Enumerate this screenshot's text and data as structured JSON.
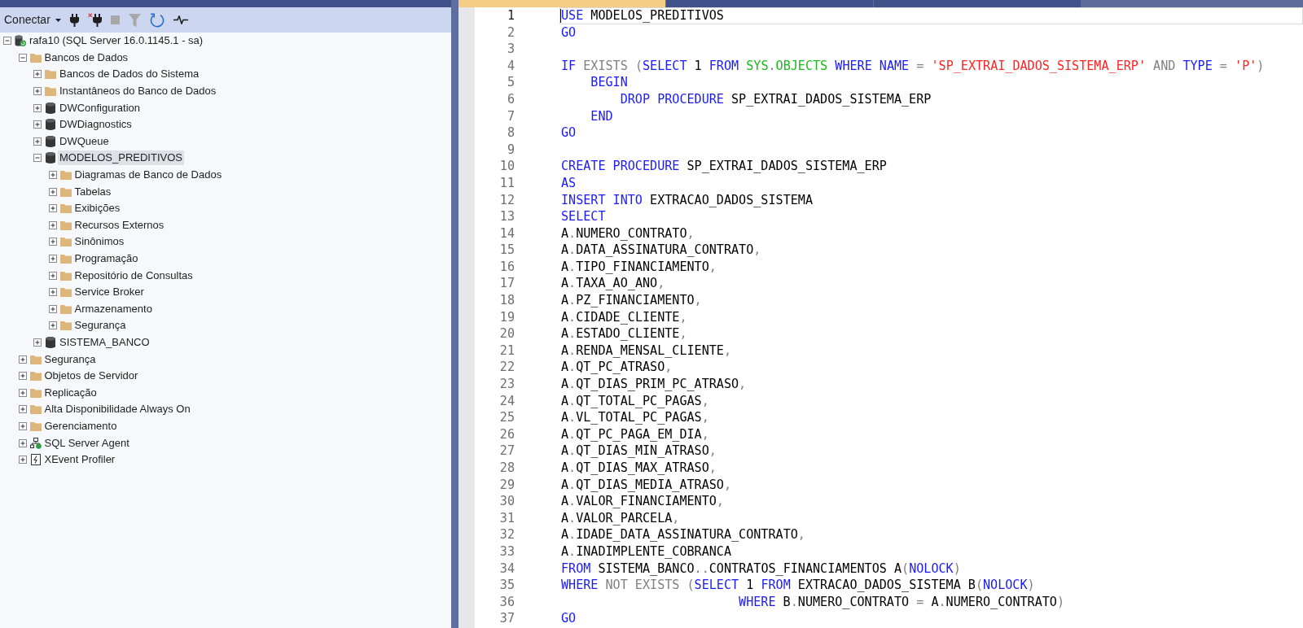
{
  "toolbar": {
    "connect_label": "Conectar",
    "buttons": [
      {
        "kind": "connect",
        "disabled": false
      },
      {
        "kind": "disconnect",
        "disabled": false
      },
      {
        "kind": "stop",
        "disabled": true
      },
      {
        "kind": "filter",
        "disabled": true
      },
      {
        "kind": "refresh",
        "disabled": false
      },
      {
        "kind": "activity",
        "disabled": false
      }
    ]
  },
  "tree": [
    {
      "label": "rafa10 (SQL Server 16.0.1145.1 - sa)",
      "kind": "server",
      "expanded": true,
      "selected": false,
      "children": [
        {
          "label": "Bancos de Dados",
          "kind": "folder",
          "expanded": true,
          "selected": false,
          "children": [
            {
              "label": "Bancos de Dados do Sistema",
              "kind": "folder",
              "expanded": false,
              "selected": false
            },
            {
              "label": "Instantâneos do Banco de Dados",
              "kind": "folder",
              "expanded": false,
              "selected": false
            },
            {
              "label": "DWConfiguration",
              "kind": "database",
              "expanded": false,
              "selected": false
            },
            {
              "label": "DWDiagnostics",
              "kind": "database",
              "expanded": false,
              "selected": false
            },
            {
              "label": "DWQueue",
              "kind": "database",
              "expanded": false,
              "selected": false
            },
            {
              "label": "MODELOS_PREDITIVOS",
              "kind": "database",
              "expanded": true,
              "selected": true,
              "children": [
                {
                  "label": "Diagramas de Banco de Dados",
                  "kind": "folder",
                  "expanded": false,
                  "selected": false
                },
                {
                  "label": "Tabelas",
                  "kind": "folder",
                  "expanded": false,
                  "selected": false
                },
                {
                  "label": "Exibições",
                  "kind": "folder",
                  "expanded": false,
                  "selected": false
                },
                {
                  "label": "Recursos Externos",
                  "kind": "folder",
                  "expanded": false,
                  "selected": false
                },
                {
                  "label": "Sinônimos",
                  "kind": "folder",
                  "expanded": false,
                  "selected": false
                },
                {
                  "label": "Programação",
                  "kind": "folder",
                  "expanded": false,
                  "selected": false
                },
                {
                  "label": "Repositório de Consultas",
                  "kind": "folder",
                  "expanded": false,
                  "selected": false
                },
                {
                  "label": "Service Broker",
                  "kind": "folder",
                  "expanded": false,
                  "selected": false
                },
                {
                  "label": "Armazenamento",
                  "kind": "folder",
                  "expanded": false,
                  "selected": false
                },
                {
                  "label": "Segurança",
                  "kind": "folder",
                  "expanded": false,
                  "selected": false
                }
              ]
            },
            {
              "label": "SISTEMA_BANCO",
              "kind": "database",
              "expanded": false,
              "selected": false
            }
          ]
        },
        {
          "label": "Segurança",
          "kind": "folder",
          "expanded": false,
          "selected": false
        },
        {
          "label": "Objetos de Servidor",
          "kind": "folder",
          "expanded": false,
          "selected": false
        },
        {
          "label": "Replicação",
          "kind": "folder",
          "expanded": false,
          "selected": false
        },
        {
          "label": "Alta Disponibilidade Always On",
          "kind": "folder",
          "expanded": false,
          "selected": false
        },
        {
          "label": "Gerenciamento",
          "kind": "folder",
          "expanded": false,
          "selected": false
        },
        {
          "label": "SQL Server Agent",
          "kind": "agent",
          "expanded": false,
          "selected": false
        },
        {
          "label": "XEvent Profiler",
          "kind": "xevent",
          "expanded": false,
          "selected": false
        }
      ]
    }
  ],
  "editor_tabs": [
    {
      "selected": true
    },
    {
      "selected": false
    },
    {
      "selected": false
    }
  ],
  "editor": {
    "lines": [
      {
        "number": "1",
        "current": true,
        "tokens": [
          {
            "kind": "keyword",
            "text": "USE"
          },
          {
            "kind": "identifier",
            "text": " MODELOS_PREDITIVOS"
          }
        ]
      },
      {
        "number": "2",
        "current": false,
        "tokens": [
          {
            "kind": "keyword",
            "text": "GO"
          }
        ]
      },
      {
        "number": "3",
        "current": false
      },
      {
        "number": "4",
        "current": false,
        "tokens": [
          {
            "kind": "keyword",
            "text": "IF"
          },
          {
            "kind": "operator",
            "text": " EXISTS ("
          },
          {
            "kind": "keyword",
            "text": "SELECT"
          },
          {
            "kind": "identifier",
            "text": " 1 "
          },
          {
            "kind": "keyword",
            "text": "FROM"
          },
          {
            "kind": "system",
            "text": " SYS"
          },
          {
            "kind": "operator",
            "text": "."
          },
          {
            "kind": "system",
            "text": "OBJECTS"
          },
          {
            "kind": "keyword",
            "text": " WHERE NAME"
          },
          {
            "kind": "operator",
            "text": " = "
          },
          {
            "kind": "string",
            "text": "'SP_EXTRAI_DADOS_SISTEMA_ERP'"
          },
          {
            "kind": "operator",
            "text": " AND "
          },
          {
            "kind": "keyword",
            "text": "TYPE"
          },
          {
            "kind": "operator",
            "text": " = "
          },
          {
            "kind": "string",
            "text": "'P'"
          },
          {
            "kind": "operator",
            "text": ")"
          }
        ]
      },
      {
        "number": "5",
        "current": false,
        "tokens": [
          {
            "kind": "keyword",
            "text": "    BEGIN"
          }
        ]
      },
      {
        "number": "6",
        "current": false,
        "tokens": [
          {
            "kind": "keyword",
            "text": "        DROP PROCEDURE"
          },
          {
            "kind": "identifier",
            "text": " SP_EXTRAI_DADOS_SISTEMA_ERP"
          }
        ]
      },
      {
        "number": "7",
        "current": false,
        "tokens": [
          {
            "kind": "keyword",
            "text": "    END"
          }
        ]
      },
      {
        "number": "8",
        "current": false,
        "tokens": [
          {
            "kind": "keyword",
            "text": "GO"
          }
        ]
      },
      {
        "number": "9",
        "current": false
      },
      {
        "number": "10",
        "current": false,
        "tokens": [
          {
            "kind": "keyword",
            "text": "CREATE PROCEDURE"
          },
          {
            "kind": "identifier",
            "text": " SP_EXTRAI_DADOS_SISTEMA_ERP"
          }
        ]
      },
      {
        "number": "11",
        "current": false,
        "tokens": [
          {
            "kind": "keyword",
            "text": "AS"
          }
        ]
      },
      {
        "number": "12",
        "current": false,
        "tokens": [
          {
            "kind": "keyword",
            "text": "INSERT INTO"
          },
          {
            "kind": "identifier",
            "text": " EXTRACAO_DADOS_SISTEMA"
          }
        ]
      },
      {
        "number": "13",
        "current": false,
        "tokens": [
          {
            "kind": "keyword",
            "text": "SELECT"
          }
        ]
      },
      {
        "number": "14",
        "current": false,
        "tokens": [
          {
            "kind": "identifier",
            "text": "A"
          },
          {
            "kind": "operator",
            "text": "."
          },
          {
            "kind": "identifier",
            "text": "NUMERO_CONTRATO"
          },
          {
            "kind": "operator",
            "text": ","
          }
        ]
      },
      {
        "number": "15",
        "current": false,
        "tokens": [
          {
            "kind": "identifier",
            "text": "A"
          },
          {
            "kind": "operator",
            "text": "."
          },
          {
            "kind": "identifier",
            "text": "DATA_ASSINATURA_CONTRATO"
          },
          {
            "kind": "operator",
            "text": ","
          }
        ]
      },
      {
        "number": "16",
        "current": false,
        "tokens": [
          {
            "kind": "identifier",
            "text": "A"
          },
          {
            "kind": "operator",
            "text": "."
          },
          {
            "kind": "identifier",
            "text": "TIPO_FINANCIAMENTO"
          },
          {
            "kind": "operator",
            "text": ","
          }
        ]
      },
      {
        "number": "17",
        "current": false,
        "tokens": [
          {
            "kind": "identifier",
            "text": "A"
          },
          {
            "kind": "operator",
            "text": "."
          },
          {
            "kind": "identifier",
            "text": "TAXA_AO_ANO"
          },
          {
            "kind": "operator",
            "text": ","
          }
        ]
      },
      {
        "number": "18",
        "current": false,
        "tokens": [
          {
            "kind": "identifier",
            "text": "A"
          },
          {
            "kind": "operator",
            "text": "."
          },
          {
            "kind": "identifier",
            "text": "PZ_FINANCIAMENTO"
          },
          {
            "kind": "operator",
            "text": ","
          }
        ]
      },
      {
        "number": "19",
        "current": false,
        "tokens": [
          {
            "kind": "identifier",
            "text": "A"
          },
          {
            "kind": "operator",
            "text": "."
          },
          {
            "kind": "identifier",
            "text": "CIDADE_CLIENTE"
          },
          {
            "kind": "operator",
            "text": ","
          }
        ]
      },
      {
        "number": "20",
        "current": false,
        "tokens": [
          {
            "kind": "identifier",
            "text": "A"
          },
          {
            "kind": "operator",
            "text": "."
          },
          {
            "kind": "identifier",
            "text": "ESTADO_CLIENTE"
          },
          {
            "kind": "operator",
            "text": ","
          }
        ]
      },
      {
        "number": "21",
        "current": false,
        "tokens": [
          {
            "kind": "identifier",
            "text": "A"
          },
          {
            "kind": "operator",
            "text": "."
          },
          {
            "kind": "identifier",
            "text": "RENDA_MENSAL_CLIENTE"
          },
          {
            "kind": "operator",
            "text": ","
          }
        ]
      },
      {
        "number": "22",
        "current": false,
        "tokens": [
          {
            "kind": "identifier",
            "text": "A"
          },
          {
            "kind": "operator",
            "text": "."
          },
          {
            "kind": "identifier",
            "text": "QT_PC_ATRASO"
          },
          {
            "kind": "operator",
            "text": ","
          }
        ]
      },
      {
        "number": "23",
        "current": false,
        "tokens": [
          {
            "kind": "identifier",
            "text": "A"
          },
          {
            "kind": "operator",
            "text": "."
          },
          {
            "kind": "identifier",
            "text": "QT_DIAS_PRIM_PC_ATRASO"
          },
          {
            "kind": "operator",
            "text": ","
          }
        ]
      },
      {
        "number": "24",
        "current": false,
        "tokens": [
          {
            "kind": "identifier",
            "text": "A"
          },
          {
            "kind": "operator",
            "text": "."
          },
          {
            "kind": "identifier",
            "text": "QT_TOTAL_PC_PAGAS"
          },
          {
            "kind": "operator",
            "text": ","
          }
        ]
      },
      {
        "number": "25",
        "current": false,
        "tokens": [
          {
            "kind": "identifier",
            "text": "A"
          },
          {
            "kind": "operator",
            "text": "."
          },
          {
            "kind": "identifier",
            "text": "VL_TOTAL_PC_PAGAS"
          },
          {
            "kind": "operator",
            "text": ","
          }
        ]
      },
      {
        "number": "26",
        "current": false,
        "tokens": [
          {
            "kind": "identifier",
            "text": "A"
          },
          {
            "kind": "operator",
            "text": "."
          },
          {
            "kind": "identifier",
            "text": "QT_PC_PAGA_EM_DIA"
          },
          {
            "kind": "operator",
            "text": ","
          }
        ]
      },
      {
        "number": "27",
        "current": false,
        "tokens": [
          {
            "kind": "identifier",
            "text": "A"
          },
          {
            "kind": "operator",
            "text": "."
          },
          {
            "kind": "identifier",
            "text": "QT_DIAS_MIN_ATRASO"
          },
          {
            "kind": "operator",
            "text": ","
          }
        ]
      },
      {
        "number": "28",
        "current": false,
        "tokens": [
          {
            "kind": "identifier",
            "text": "A"
          },
          {
            "kind": "operator",
            "text": "."
          },
          {
            "kind": "identifier",
            "text": "QT_DIAS_MAX_ATRASO"
          },
          {
            "kind": "operator",
            "text": ","
          }
        ]
      },
      {
        "number": "29",
        "current": false,
        "tokens": [
          {
            "kind": "identifier",
            "text": "A"
          },
          {
            "kind": "operator",
            "text": "."
          },
          {
            "kind": "identifier",
            "text": "QT_DIAS_MEDIA_ATRASO"
          },
          {
            "kind": "operator",
            "text": ","
          }
        ]
      },
      {
        "number": "30",
        "current": false,
        "tokens": [
          {
            "kind": "identifier",
            "text": "A"
          },
          {
            "kind": "operator",
            "text": "."
          },
          {
            "kind": "identifier",
            "text": "VALOR_FINANCIAMENTO"
          },
          {
            "kind": "operator",
            "text": ","
          }
        ]
      },
      {
        "number": "31",
        "current": false,
        "tokens": [
          {
            "kind": "identifier",
            "text": "A"
          },
          {
            "kind": "operator",
            "text": "."
          },
          {
            "kind": "identifier",
            "text": "VALOR_PARCELA"
          },
          {
            "kind": "operator",
            "text": ","
          }
        ]
      },
      {
        "number": "32",
        "current": false,
        "tokens": [
          {
            "kind": "identifier",
            "text": "A"
          },
          {
            "kind": "operator",
            "text": "."
          },
          {
            "kind": "identifier",
            "text": "IDADE_DATA_ASSINATURA_CONTRATO"
          },
          {
            "kind": "operator",
            "text": ","
          }
        ]
      },
      {
        "number": "33",
        "current": false,
        "tokens": [
          {
            "kind": "identifier",
            "text": "A"
          },
          {
            "kind": "operator",
            "text": "."
          },
          {
            "kind": "identifier",
            "text": "INADIMPLENTE_COBRANCA"
          }
        ]
      },
      {
        "number": "34",
        "current": false,
        "tokens": [
          {
            "kind": "keyword",
            "text": "FROM"
          },
          {
            "kind": "identifier",
            "text": " SISTEMA_BANCO"
          },
          {
            "kind": "operator",
            "text": ".."
          },
          {
            "kind": "identifier",
            "text": "CONTRATOS_FINANCIAMENTOS A"
          },
          {
            "kind": "operator",
            "text": "("
          },
          {
            "kind": "keyword",
            "text": "NOLOCK"
          },
          {
            "kind": "operator",
            "text": ")"
          }
        ]
      },
      {
        "number": "35",
        "current": false,
        "tokens": [
          {
            "kind": "keyword",
            "text": "WHERE"
          },
          {
            "kind": "operator",
            "text": " NOT EXISTS ("
          },
          {
            "kind": "keyword",
            "text": "SELECT"
          },
          {
            "kind": "identifier",
            "text": " 1 "
          },
          {
            "kind": "keyword",
            "text": "FROM"
          },
          {
            "kind": "identifier",
            "text": " EXTRACAO_DADOS_SISTEMA B"
          },
          {
            "kind": "operator",
            "text": "("
          },
          {
            "kind": "keyword",
            "text": "NOLOCK"
          },
          {
            "kind": "operator",
            "text": ")"
          }
        ]
      },
      {
        "number": "36",
        "current": false,
        "tokens": [
          {
            "kind": "keyword",
            "text": "                        WHERE"
          },
          {
            "kind": "identifier",
            "text": " B"
          },
          {
            "kind": "operator",
            "text": "."
          },
          {
            "kind": "identifier",
            "text": "NUMERO_CONTRATO "
          },
          {
            "kind": "operator",
            "text": "="
          },
          {
            "kind": "identifier",
            "text": " A"
          },
          {
            "kind": "operator",
            "text": "."
          },
          {
            "kind": "identifier",
            "text": "NUMERO_CONTRATO"
          },
          {
            "kind": "operator",
            "text": ")"
          }
        ]
      },
      {
        "number": "37",
        "current": false,
        "tokens": [
          {
            "kind": "keyword",
            "text": "GO"
          }
        ]
      }
    ]
  }
}
